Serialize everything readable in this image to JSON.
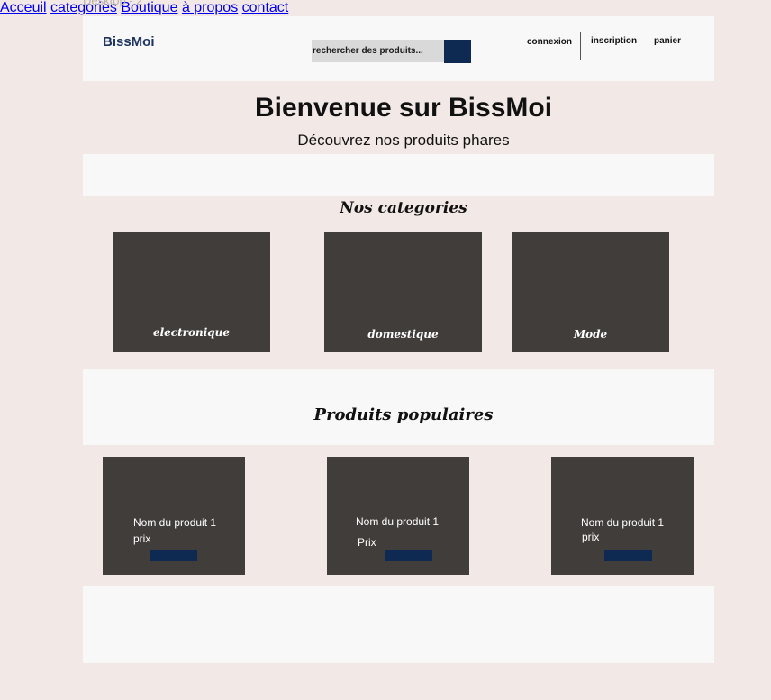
{
  "frame": {
    "label": "Desktop - 2"
  },
  "header": {
    "logo": "BissMoi",
    "search_placeholder": "rechercher des produits...",
    "links": {
      "connexion": "connexion",
      "inscription": "inscription",
      "panier": "panier"
    }
  },
  "hero": {
    "title": "Bienvenue sur BissMoi",
    "subtitle": "Découvrez nos produits phares"
  },
  "nav": {
    "items": [
      "Acceuil",
      "categories",
      "Boutique",
      "à propos",
      "contact"
    ]
  },
  "categories": {
    "title": "Nos categories",
    "items": [
      "electronique",
      "domestique",
      "Mode"
    ]
  },
  "popular": {
    "title": "Produits populaires",
    "products": [
      {
        "name": "Nom du produit 1",
        "price": "prix"
      },
      {
        "name": "Nom du produit 1",
        "price": "Prix"
      },
      {
        "name": "Nom du produit 1",
        "price": "prix"
      }
    ]
  },
  "colors": {
    "brand": "#1d3461",
    "button": "#0f2a52",
    "card": "#403d3b",
    "page_bg": "#f2e8e6",
    "band_bg": "#f8f8f8"
  }
}
